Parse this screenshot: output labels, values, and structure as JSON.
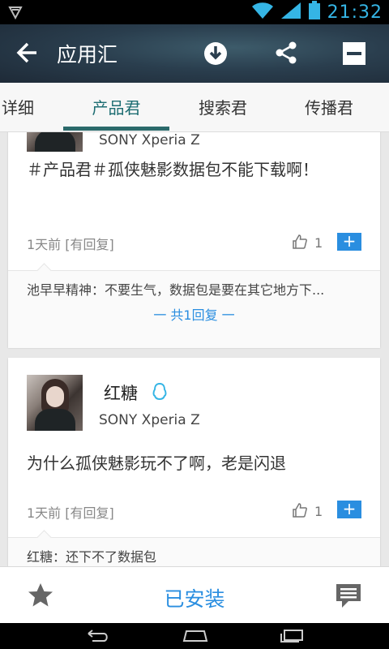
{
  "status_bar": {
    "time": "21:32"
  },
  "app_bar": {
    "title": "应用汇"
  },
  "tabs": [
    {
      "label": "详细"
    },
    {
      "label": "产品君"
    },
    {
      "label": "搜索君"
    },
    {
      "label": "传播君"
    }
  ],
  "posts": [
    {
      "device": "SONY Xperia Z",
      "text": "＃产品君＃孤侠魅影数据包不能下载啊！",
      "meta": "1天前 [有回复]",
      "likes": "1",
      "reply": "池早早精神：不要生气，数据包是要在其它地方下...",
      "reply_count": "一 共1回复 一"
    },
    {
      "username": "红糖",
      "device": "SONY Xperia Z",
      "text": "为什么孤侠魅影玩不了啊，老是闪退",
      "meta": "1天前 [有回复]",
      "likes": "1",
      "reply": "红糖：还下不了数据包"
    }
  ],
  "bottom_bar": {
    "installed_label": "已安装"
  },
  "colors": {
    "accent": "#2a8ee0",
    "tab_active": "#2b6a6b",
    "status_icon": "#35b5e5"
  }
}
